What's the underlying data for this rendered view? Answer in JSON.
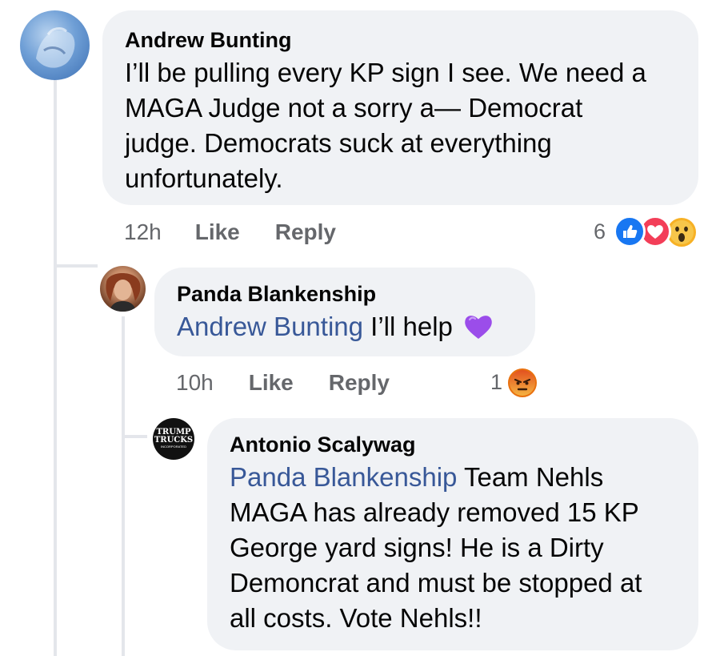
{
  "comments": [
    {
      "author": "Andrew Bunting",
      "text": "I’ll be pulling every KP sign I see. We need a MAGA Judge not a sorry a— Democrat judge. Democrats suck at everything unfortunately.",
      "line1": "I’ll be pulling every KP sign I see. We need a",
      "line2": "MAGA Judge not a sorry a— Democrat",
      "line3": "judge. Democrats suck at everything",
      "line4": "unfortunately.",
      "time": "12h",
      "like_label": "Like",
      "reply_label": "Reply",
      "reaction_count": "6",
      "reactions": [
        "like-icon",
        "love-icon",
        "wow-icon"
      ]
    },
    {
      "author": "Panda Blankenship",
      "mention": "Andrew Bunting",
      "text": "I’ll help",
      "emoji": "💜",
      "time": "10h",
      "like_label": "Like",
      "reply_label": "Reply",
      "reaction_count": "1",
      "reactions": [
        "angry-icon"
      ]
    },
    {
      "author": "Antonio Scalywag",
      "avatar_text_top": "TRUMP",
      "avatar_text_mid": "TRUCKS",
      "avatar_text_bottom": "INCORPORATED",
      "mention": "Panda Blankenship",
      "line1": "Team Nehls",
      "line2": "MAGA has already removed 15 KP",
      "line3": "George yard signs! He is a Dirty",
      "line4": "Demoncrat and must be stopped at",
      "line5": "all costs. Vote Nehls!!"
    }
  ],
  "colors": {
    "bubble": "#f0f2f5",
    "mention": "#385898",
    "meta": "#65676b",
    "like_blue": "#1877f2",
    "love_red": "#f33e58",
    "angry_orange": "#e9710f"
  }
}
